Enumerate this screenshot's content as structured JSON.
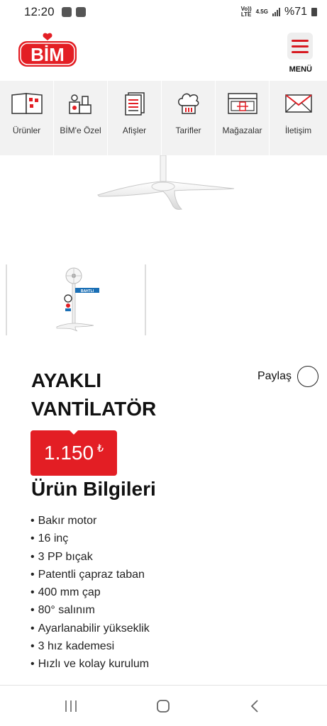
{
  "status_bar": {
    "time": "12:20",
    "network_line1": "Vo))",
    "network_line2": "LTE",
    "network_type": "4.5G",
    "battery": "%71"
  },
  "header": {
    "logo_text": "BİM",
    "menu_label": "MENÜ",
    "brand_color": "#e31e24"
  },
  "nav": {
    "items": [
      {
        "label": "Ürünler",
        "icon": "catalog-icon"
      },
      {
        "label": "BİM'e Özel",
        "icon": "products-icon"
      },
      {
        "label": "Afişler",
        "icon": "posters-icon"
      },
      {
        "label": "Tarifler",
        "icon": "chef-hat-icon"
      },
      {
        "label": "Mağazalar",
        "icon": "store-icon"
      },
      {
        "label": "İletişim",
        "icon": "envelope-icon"
      }
    ]
  },
  "product": {
    "title_line1": "AYAKLI",
    "title_line2": "VANTİLATÖR",
    "price": "1.150",
    "currency": "₺",
    "share_label": "Paylaş",
    "thumb_brand": "BAHTLI"
  },
  "info": {
    "heading": "Ürün Bilgileri",
    "features": [
      "Bakır motor",
      "16 inç",
      "3 PP bıçak",
      "Patentli çapraz taban",
      "400 mm çap",
      "80° salınım",
      "Ayarlanabilir yükseklik",
      "3 hız kademesi",
      "Hızlı ve kolay kurulum"
    ]
  }
}
